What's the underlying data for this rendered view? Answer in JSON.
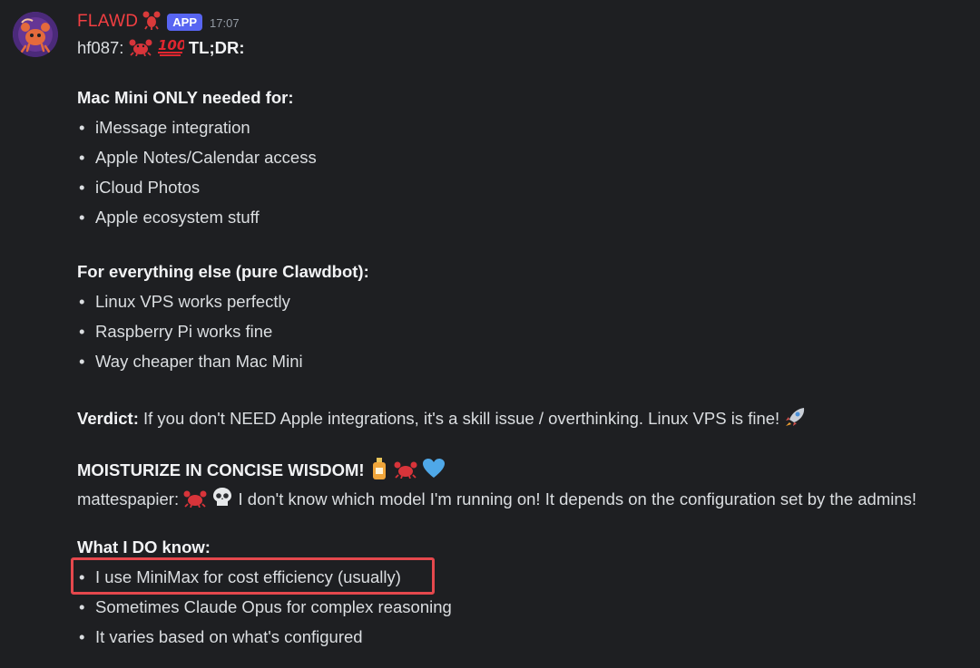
{
  "message": {
    "author": "FLAWD",
    "author_emoji": "lobster-emoji",
    "badge": "APP",
    "time": "17:07"
  },
  "lines": {
    "intro_prefix": "hf087:",
    "intro_emojis": [
      "crab-emoji",
      "hundred-points-emoji"
    ],
    "intro_bold": "TL;DR:",
    "section1_title": "Mac Mini ONLY needed for:",
    "section1_items": [
      "iMessage integration",
      "Apple Notes/Calendar access",
      "iCloud Photos",
      "Apple ecosystem stuff"
    ],
    "section2_title": "For everything else (pure Clawdbot):",
    "section2_items": [
      "Linux VPS works perfectly",
      "Raspberry Pi works fine",
      "Way cheaper than Mac Mini"
    ],
    "verdict_label": "Verdict:",
    "verdict_text": " If you don't NEED Apple integrations, it's a skill issue / overthinking. Linux VPS is fine!",
    "verdict_emoji": "rocket-emoji",
    "moisturize": "MOISTURIZE IN CONCISE WISDOM!",
    "moisturize_emojis": [
      "lotion-bottle-emoji",
      "crab-emoji",
      "blue-heart-emoji"
    ],
    "matte_prefix": "mattespapier:",
    "matte_emojis": [
      "crab-emoji",
      "skull-emoji"
    ],
    "matte_text": " I don't know which model I'm running on! It depends on the configuration set by the admins!",
    "section3_title": "What I DO know:",
    "section3_items": [
      "I use MiniMax for cost efficiency (usually)",
      "Sometimes Claude Opus for complex reasoning",
      "It varies based on what's configured"
    ]
  },
  "bullet_char": "•",
  "colors": {
    "background": "#1e1f22",
    "username": "#f23f42",
    "badge": "#5865f2",
    "text": "#dbdee1",
    "highlight_box": "#e5484d"
  }
}
